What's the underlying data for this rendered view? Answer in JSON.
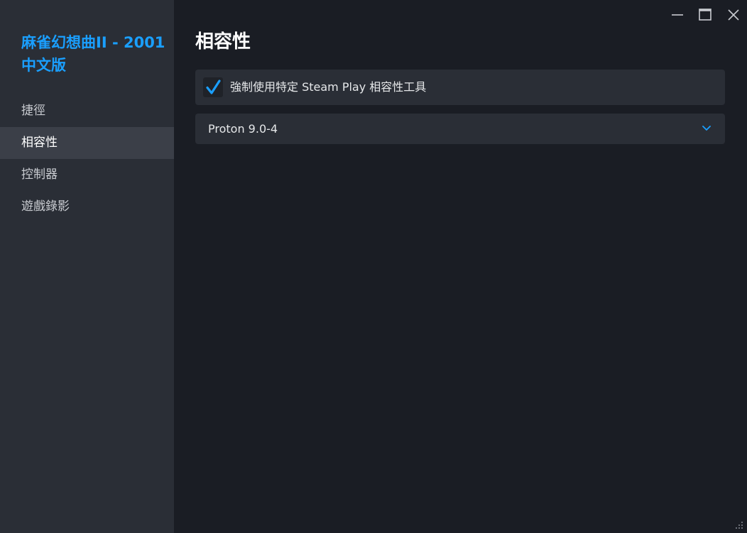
{
  "sidebar": {
    "game_title": "麻雀幻想曲II - 2001 中文版",
    "items": [
      {
        "label": "捷徑",
        "active": false
      },
      {
        "label": "相容性",
        "active": true
      },
      {
        "label": "控制器",
        "active": false
      },
      {
        "label": "遊戲錄影",
        "active": false
      }
    ]
  },
  "main": {
    "title": "相容性",
    "force_tool": {
      "label": "強制使用特定 Steam Play 相容性工具",
      "checked": true
    },
    "tool_select": {
      "value": "Proton 9.0-4"
    }
  },
  "window_controls": {
    "minimize_icon": "minimize-icon",
    "maximize_icon": "maximize-icon",
    "close_icon": "close-icon"
  },
  "colors": {
    "accent": "#1a9fff",
    "background": "#1a1d24",
    "sidebar": "#2a2e36",
    "active_item": "#3b3f48"
  }
}
